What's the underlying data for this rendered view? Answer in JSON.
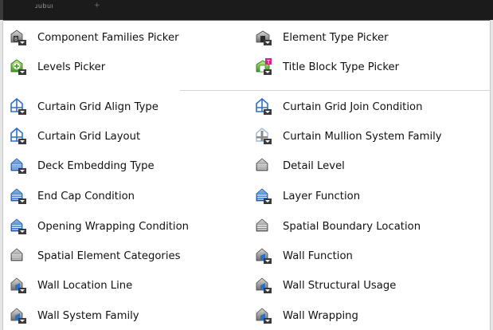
{
  "window": {
    "title_fragment": "ɹubuı",
    "tab_plus": "+"
  },
  "section_pickers": [
    {
      "label": "Component Families Picker",
      "icon": "component-families-picker-icon"
    },
    {
      "label": "Element Type Picker",
      "icon": "element-type-picker-icon"
    },
    {
      "label": "Levels Picker",
      "icon": "levels-picker-icon"
    },
    {
      "label": "Title Block Type Picker",
      "icon": "title-block-type-picker-icon"
    }
  ],
  "section_types": [
    {
      "label": "Curtain Grid Align Type",
      "icon": "curtain-grid-icon"
    },
    {
      "label": "Curtain Grid Join Condition",
      "icon": "curtain-grid-icon"
    },
    {
      "label": "Curtain Grid Layout",
      "icon": "curtain-grid-icon"
    },
    {
      "label": "Curtain Mullion System Family",
      "icon": "curtain-mullion-icon"
    },
    {
      "label": "Deck Embedding Type",
      "icon": "layered-wall-icon"
    },
    {
      "label": "Detail Level",
      "icon": "detail-level-icon"
    },
    {
      "label": "End Cap Condition",
      "icon": "layered-wall-icon"
    },
    {
      "label": "Layer Function",
      "icon": "layered-wall-icon"
    },
    {
      "label": "Opening Wrapping Condition",
      "icon": "layered-wall-icon"
    },
    {
      "label": "Spatial Boundary Location",
      "icon": "detail-level-icon"
    },
    {
      "label": "Spatial Element Categories",
      "icon": "detail-level-icon"
    },
    {
      "label": "Wall Function",
      "icon": "wall-icon"
    },
    {
      "label": "Wall Location Line",
      "icon": "wall-icon"
    },
    {
      "label": "Wall Structural Usage",
      "icon": "wall-icon"
    },
    {
      "label": "Wall System Family",
      "icon": "wall-icon"
    },
    {
      "label": "Wall Wrapping",
      "icon": "wall-icon"
    }
  ],
  "colors": {
    "topbar": "#1b1b1b",
    "icon_blue": "#2f6fc6",
    "icon_gray": "#8a8a8a",
    "icon_green": "#4fb23a",
    "badge_magenta": "#d21f8a"
  }
}
